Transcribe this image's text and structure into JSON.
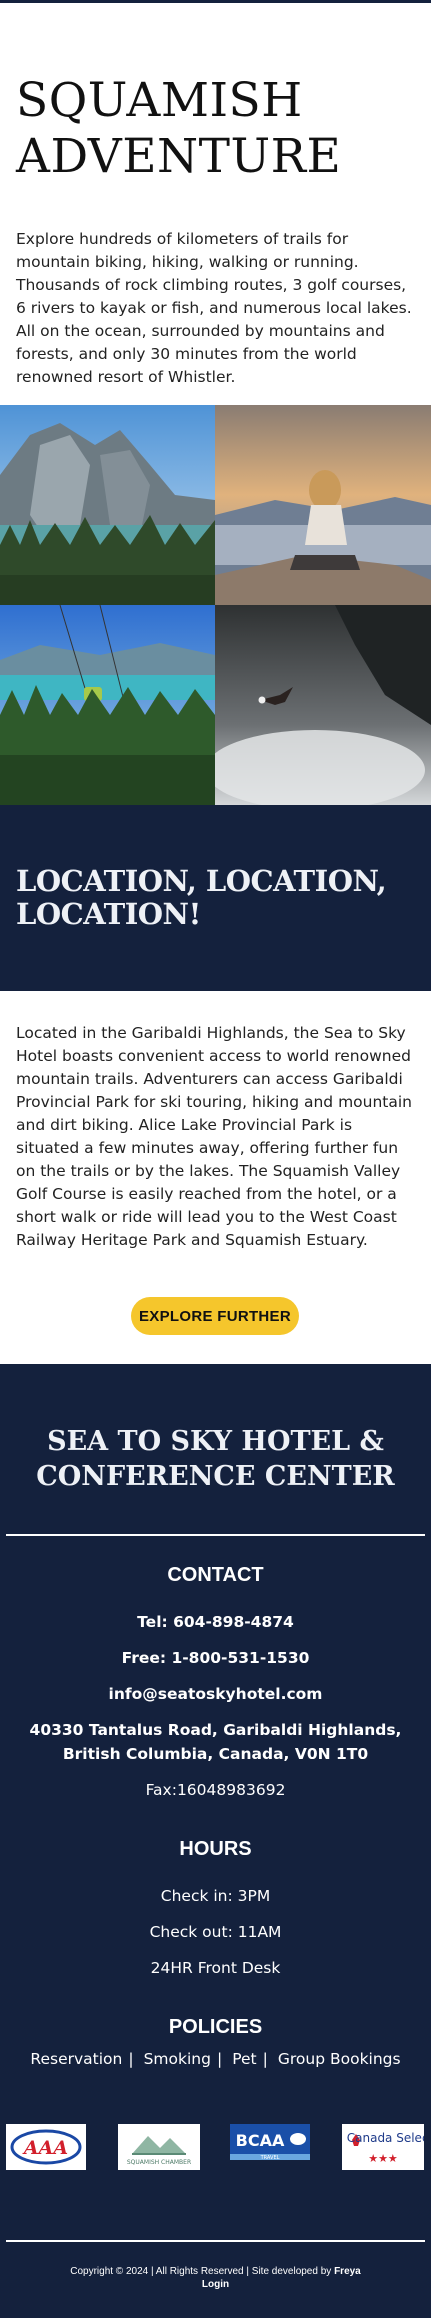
{
  "hero": {
    "title_line1": "SQUAMISH",
    "title_line2": "ADVENTURE",
    "intro": "Explore hundreds of kilometers of trails for mountain biking, hiking, walking or running. Thousands of rock climbing routes, 3 golf courses, 6 rivers to kayak or fish, and numerous local lakes. All on the ocean, surrounded by mountains and forests, and only 30 minutes from the world renowned resort of Whistler."
  },
  "location": {
    "heading": "LOCATION, LOCATION, LOCATION!",
    "text": "Located in the Garibaldi Highlands, the Sea to Sky Hotel boasts convenient access to world renowned mountain trails. Adventurers can access Garibaldi Provincial Park for ski touring, hiking and mountain and dirt biking. Alice Lake Provincial Park is situated a few minutes away, offering further fun on the trails or by the lakes. The Squamish Valley Golf Course is easily reached from the hotel, or a short walk or ride will lead you to the West Coast Railway Heritage Park and Squamish Estuary.",
    "button": "EXPLORE FURTHER"
  },
  "footer": {
    "title": "SEA TO SKY HOTEL & CONFERENCE CENTER",
    "contact": {
      "heading": "CONTACT",
      "tel": "Tel: 604-898-4874",
      "free": "Free: 1-800-531-1530",
      "email": "info@seatoskyhotel.com",
      "address": "40330 Tantalus Road, Garibaldi Highlands, British Columbia, Canada, V0N 1T0",
      "fax": "Fax:16048983692"
    },
    "hours": {
      "heading": "HOURS",
      "checkin": "Check in: 3PM",
      "checkout": "Check out: 11AM",
      "desk": "24HR Front Desk"
    },
    "policies": {
      "heading": "POLICIES",
      "items": [
        "Reservation",
        "Smoking",
        "Pet",
        "Group Bookings"
      ],
      "separator": "|"
    },
    "logos": {
      "aaa": "AAA",
      "chamber": "SQUAMISH CHAMBER",
      "bcaa": "BCAA",
      "bcaa_sub": "TRAVEL",
      "canada_select": "Canada Select",
      "stars": "★★★"
    },
    "copyright_prefix": "Copyright © 2024 | All Rights Reserved | Site developed by ",
    "copyright_dev": "Freya",
    "login": "Login"
  }
}
